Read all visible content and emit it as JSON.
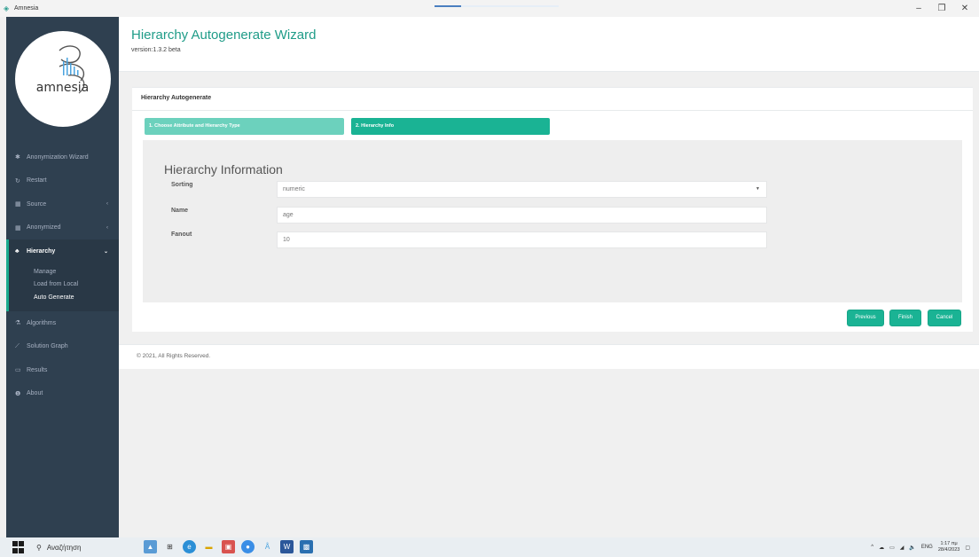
{
  "window": {
    "title": "Amnesia"
  },
  "header": {
    "title": "Hierarchy Autogenerate Wizard",
    "version": "version:1.3.2 beta"
  },
  "logo": {
    "text": "amnesia"
  },
  "sidebar": {
    "items": [
      {
        "label": "Anonymization Wizard",
        "icon": "magic-icon"
      },
      {
        "label": "Restart",
        "icon": "refresh-icon"
      },
      {
        "label": "Source",
        "icon": "table-icon",
        "has_chevron": true
      },
      {
        "label": "Anonymized",
        "icon": "table-icon",
        "has_chevron": true
      },
      {
        "label": "Hierarchy",
        "icon": "sitemap-icon",
        "has_chevron": true,
        "active": true
      },
      {
        "label": "Algorithms",
        "icon": "flask-icon"
      },
      {
        "label": "Solution Graph",
        "icon": "line-chart-icon"
      },
      {
        "label": "Results",
        "icon": "desktop-icon"
      },
      {
        "label": "About",
        "icon": "info-icon"
      }
    ],
    "hierarchy_sub": [
      "Manage",
      "Load from Local",
      "Auto Generate"
    ]
  },
  "panel": {
    "title": "Hierarchy Autogenerate",
    "steps": [
      "1. Choose Attribute and Hierarchy Type",
      "2. Hierarchy Info"
    ],
    "section_title": "Hierarchy Information",
    "fields": {
      "sorting": {
        "label": "Sorting",
        "value": "numeric"
      },
      "name": {
        "label": "Name",
        "value": "age"
      },
      "fanout": {
        "label": "Fanout",
        "value": "10"
      }
    },
    "buttons": {
      "previous": "Previous",
      "finish": "Finish",
      "cancel": "Cancel"
    }
  },
  "footer": {
    "text": "© 2021, All Rights Reserved."
  },
  "taskbar": {
    "search": "Αναζήτηση",
    "lang": "ENG",
    "time": "1:17 πμ",
    "date": "28/4/2023"
  },
  "colors": {
    "accent": "#1ab394",
    "sidebar": "#2f4050"
  }
}
